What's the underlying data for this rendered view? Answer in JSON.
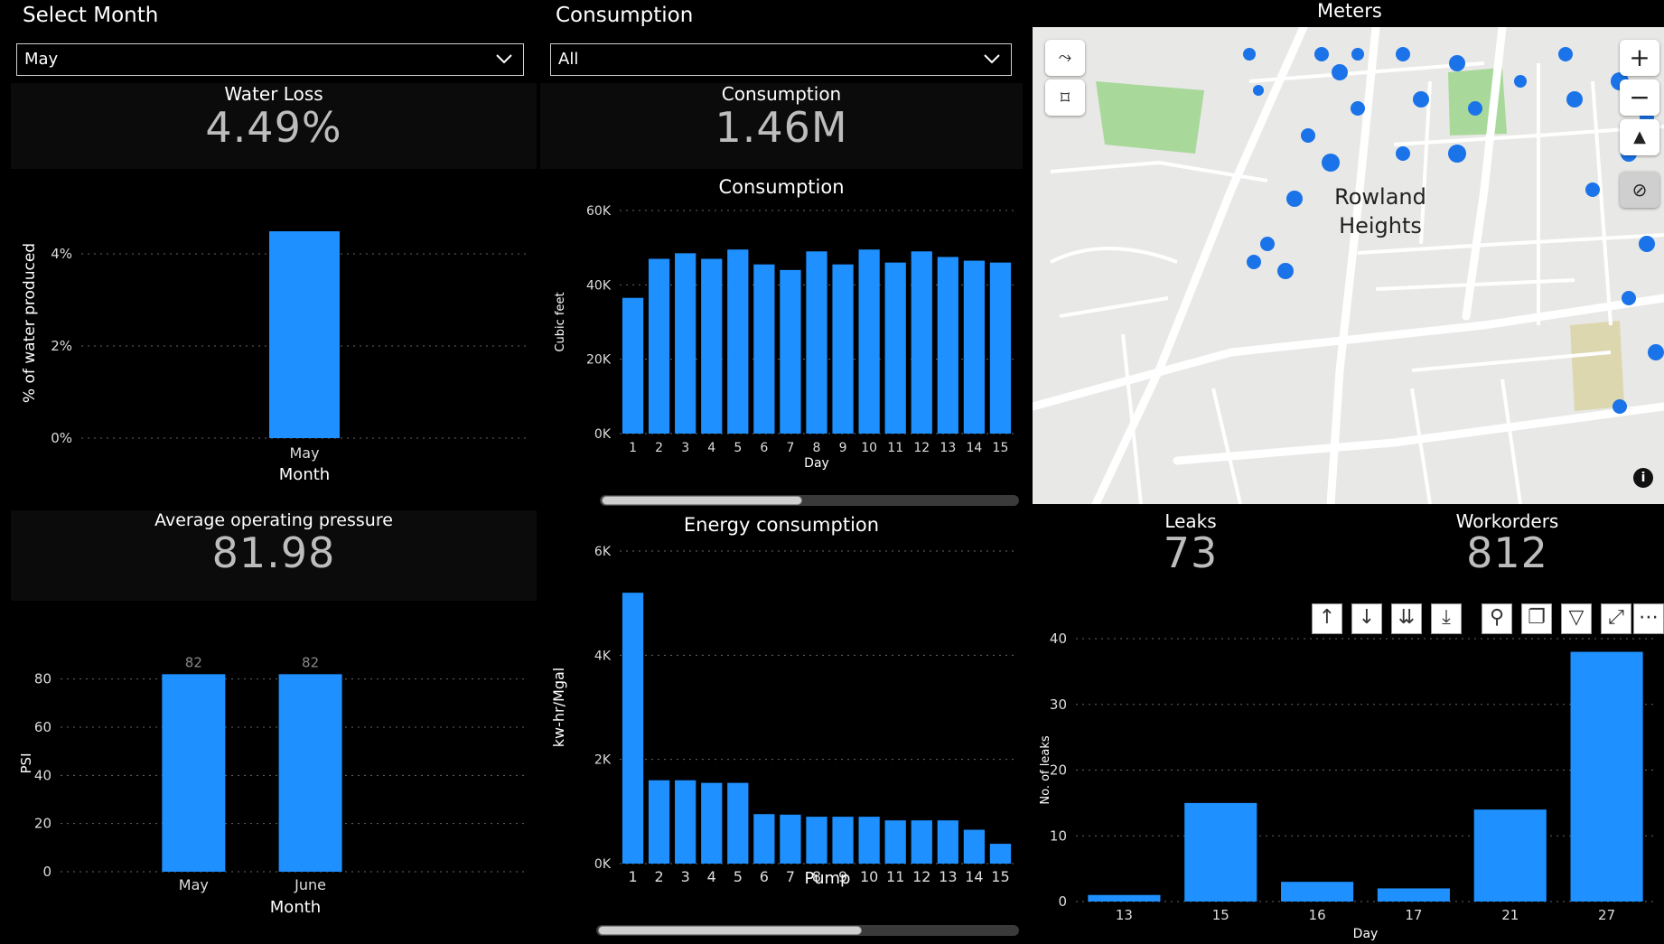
{
  "filters": {
    "month": {
      "title": "Select Month",
      "value": "May"
    },
    "consumption": {
      "title": "Consumption",
      "value": "All"
    }
  },
  "meters": {
    "title": "Meters",
    "place_label_1": "Rowland",
    "place_label_2": "Heights"
  },
  "kpis": {
    "water_loss": {
      "title": "Water Loss",
      "value": "4.49%"
    },
    "consumption": {
      "title": "Consumption",
      "value": "1.46M"
    },
    "pressure": {
      "title": "Average operating pressure",
      "value": "81.98"
    },
    "leaks": {
      "title": "Leaks",
      "value": "73"
    },
    "workorders": {
      "title": "Workorders",
      "value": "812"
    }
  },
  "icons": {
    "dropdown": "chevron-down-icon",
    "map_tools": [
      "lasso-icon",
      "rectangle-select-icon"
    ],
    "map_zoom": [
      "zoom-in-icon",
      "zoom-out-icon",
      "compass-icon",
      "locate-off-icon",
      "info-icon"
    ],
    "visual_toolbar": [
      "drill-up-icon",
      "drill-down-icon",
      "expand-all-icon",
      "expand-next-icon",
      "pin-icon",
      "copy-icon",
      "filter-icon",
      "focus-mode-icon",
      "more-options-icon"
    ]
  },
  "chart_data": [
    {
      "id": "water_loss",
      "type": "bar",
      "categories": [
        "May"
      ],
      "values": [
        4.49
      ],
      "xlabel": "Month",
      "ylabel": "% of water produced",
      "yticks": [
        "0%",
        "2%",
        "4%"
      ],
      "ylim": [
        0,
        5
      ],
      "grid": true,
      "color": "#1E90FF"
    },
    {
      "id": "consumption",
      "type": "bar",
      "title": "Consumption",
      "categories": [
        "1",
        "2",
        "3",
        "4",
        "5",
        "6",
        "7",
        "8",
        "9",
        "10",
        "11",
        "12",
        "13",
        "14",
        "15"
      ],
      "values": [
        36500,
        47000,
        48500,
        47000,
        49500,
        45500,
        44000,
        49000,
        45500,
        49500,
        46000,
        49000,
        47500,
        46500,
        46000
      ],
      "xlabel": "Day",
      "ylabel": "Cubic feet",
      "yticks": [
        "0K",
        "20K",
        "40K",
        "60K"
      ],
      "ylim": [
        0,
        60000
      ],
      "grid": true,
      "color": "#1E90FF"
    },
    {
      "id": "pressure",
      "type": "bar",
      "categories": [
        "May",
        "June"
      ],
      "values": [
        82,
        82
      ],
      "data_labels": [
        "82",
        "82"
      ],
      "xlabel": "Month",
      "ylabel": "PSI",
      "yticks": [
        "0",
        "20",
        "40",
        "60",
        "80"
      ],
      "ylim": [
        0,
        90
      ],
      "grid": true,
      "color": "#1E90FF"
    },
    {
      "id": "energy",
      "type": "bar",
      "title": "Energy consumption",
      "categories": [
        "1",
        "2",
        "3",
        "4",
        "5",
        "6",
        "7",
        "8",
        "9",
        "10",
        "11",
        "12",
        "13",
        "14",
        "15"
      ],
      "values": [
        5200,
        1600,
        1600,
        1550,
        1550,
        950,
        940,
        900,
        900,
        900,
        830,
        830,
        830,
        650,
        380
      ],
      "xlabel": "Pump",
      "ylabel": "kw-hr/Mgal",
      "yticks": [
        "0K",
        "2K",
        "4K",
        "6K"
      ],
      "ylim": [
        0,
        6000
      ],
      "grid": true,
      "color": "#1E90FF"
    },
    {
      "id": "leaks",
      "type": "bar",
      "categories": [
        "13",
        "15",
        "16",
        "17",
        "21",
        "27"
      ],
      "values": [
        1,
        15,
        3,
        2,
        14,
        38
      ],
      "xlabel": "Day",
      "ylabel": "No. of leaks",
      "yticks": [
        "0",
        "10",
        "20",
        "30",
        "40"
      ],
      "ylim": [
        0,
        40
      ],
      "grid": true,
      "color": "#1E90FF"
    }
  ]
}
